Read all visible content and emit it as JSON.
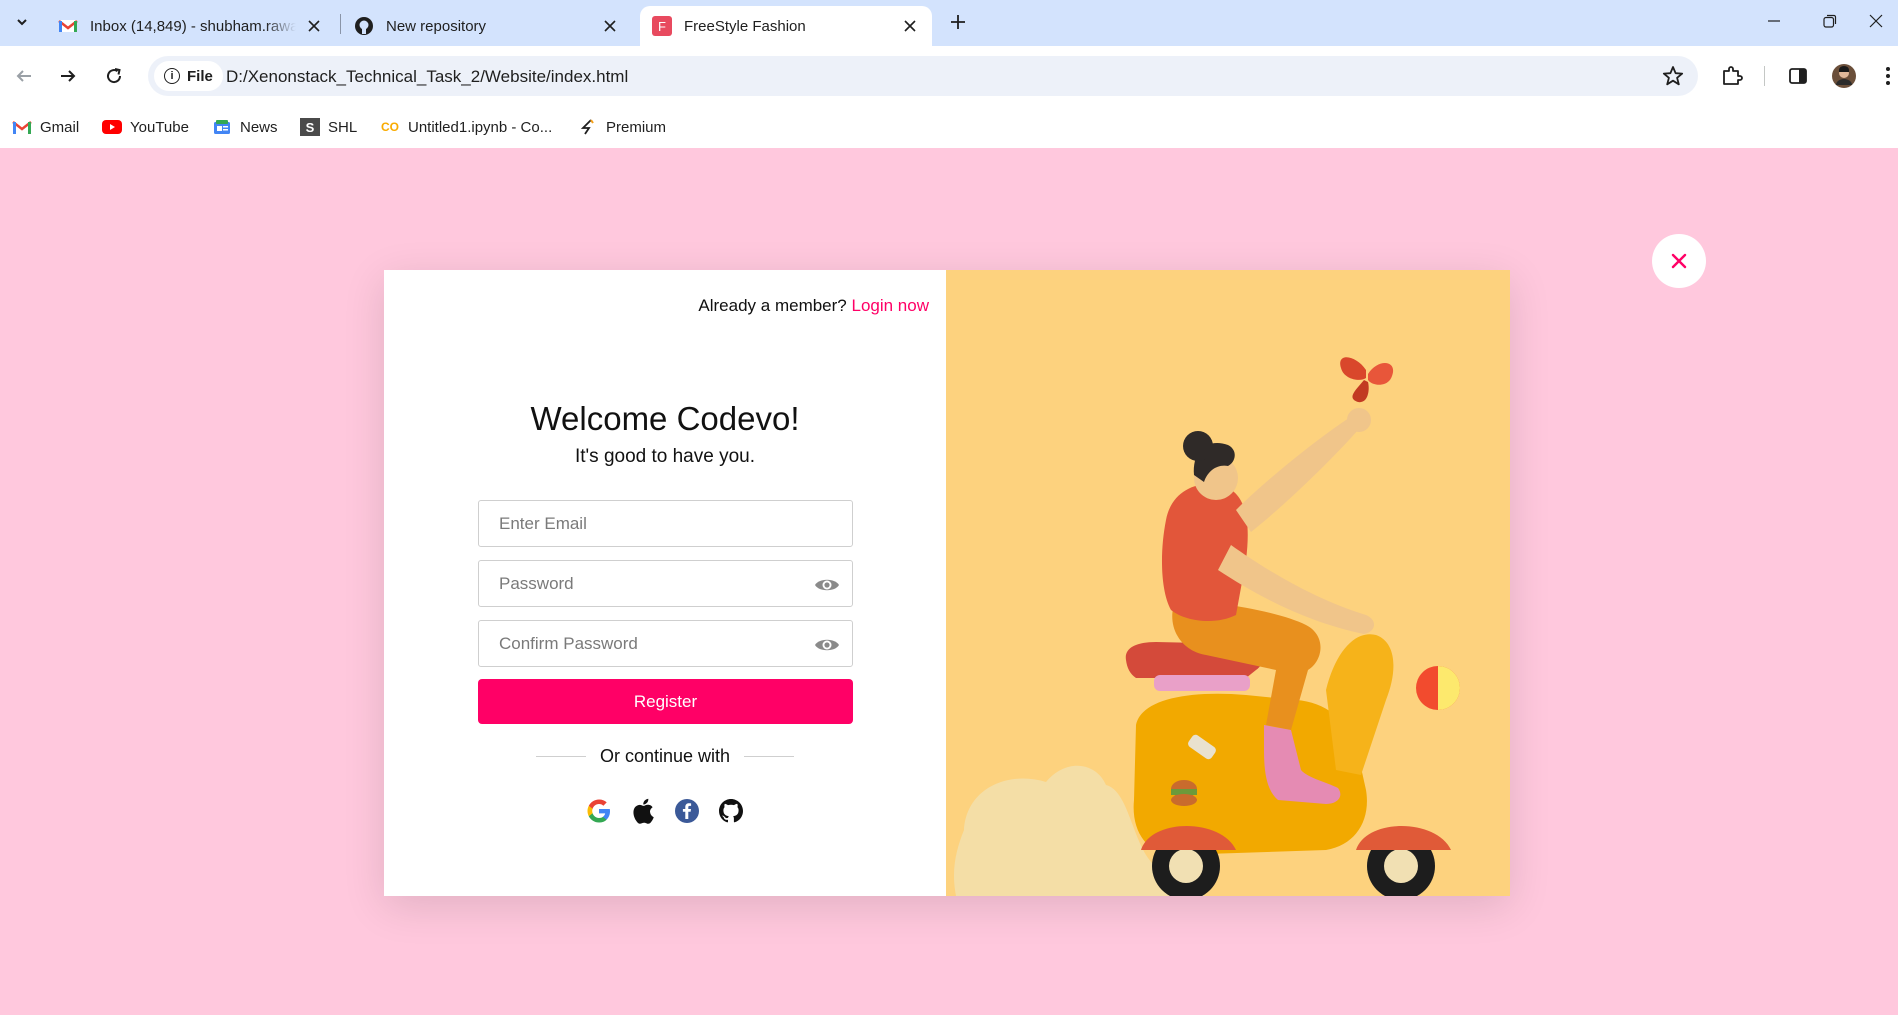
{
  "browser": {
    "tabs": [
      {
        "title": "Inbox (14,849) - shubham.rawat",
        "favicon": "gmail-icon",
        "active": false
      },
      {
        "title": "New repository",
        "favicon": "github-icon",
        "active": false
      },
      {
        "title": "FreeStyle Fashion",
        "favicon": "freestyle-icon",
        "favicon_letter": "F",
        "active": true
      }
    ],
    "address": {
      "chip_label": "File",
      "url": "D:/Xenonstack_Technical_Task_2/Website/index.html"
    },
    "bookmarks": [
      {
        "label": "Gmail",
        "icon": "gmail-icon"
      },
      {
        "label": "YouTube",
        "icon": "youtube-icon"
      },
      {
        "label": "News",
        "icon": "news-icon"
      },
      {
        "label": "SHL",
        "icon": "shl-icon",
        "icon_letter": "S"
      },
      {
        "label": "Untitled1.ipynb - Co...",
        "icon": "colab-icon",
        "icon_letter": "CO"
      },
      {
        "label": "Premium",
        "icon": "premium-icon"
      }
    ]
  },
  "form": {
    "member_prompt": "Already a member?",
    "login_link": "Login now",
    "title": "Welcome Codevo!",
    "subtitle": "It's good to have you.",
    "email_placeholder": "Enter Email",
    "password_placeholder": "Password",
    "confirm_placeholder": "Confirm Password",
    "register_label": "Register",
    "divider_text": "Or continue with",
    "social_logins": [
      "google-icon",
      "apple-icon",
      "facebook-icon",
      "github-icon"
    ]
  },
  "colors": {
    "page_background": "#ffc8dd",
    "accent": "#ff0066",
    "art_background": "#fdd27e",
    "tabstrip": "#d3e3fd"
  }
}
